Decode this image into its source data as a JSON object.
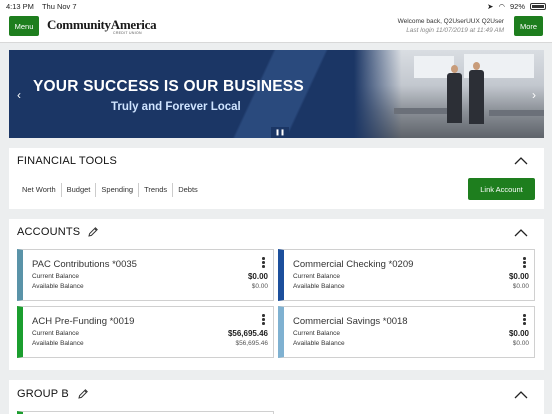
{
  "status_bar": {
    "time": "4:13 PM",
    "date": "Thu Nov 7",
    "battery": "92%",
    "battery_level": 0.92
  },
  "header": {
    "menu_label": "Menu",
    "more_label": "More",
    "logo_text": "CommunityAmerica",
    "logo_sub": "CREDIT UNION",
    "welcome": "Welcome back, Q2UserUUX Q2User",
    "last_login": "Last login 11/07/2019 at 11:49 AM"
  },
  "banner": {
    "headline": "YOUR SUCCESS IS OUR BUSINESS",
    "subline": "Truly and Forever Local",
    "prev_icon": "‹",
    "next_icon": "›",
    "pause_icon": "❚❚"
  },
  "financial_tools": {
    "title": "FINANCIAL TOOLS",
    "links": [
      "Net Worth",
      "Budget",
      "Spending",
      "Trends",
      "Debts"
    ],
    "link_account_label": "Link Account"
  },
  "accounts": {
    "title": "ACCOUNTS",
    "current_label": "Current Balance",
    "available_label": "Available Balance",
    "items": [
      {
        "name": "PAC Contributions *0035",
        "current": "$0.00",
        "available": "$0.00",
        "color": "#5a93a8"
      },
      {
        "name": "Commercial Checking *0209",
        "current": "$0.00",
        "available": "$0.00",
        "color": "#1c4f9c"
      },
      {
        "name": "ACH Pre-Funding *0019",
        "current": "$56,695.46",
        "available": "$56,695.46",
        "color": "#1b9e2e"
      },
      {
        "name": "Commercial Savings *0018",
        "current": "$0.00",
        "available": "$0.00",
        "color": "#7fb1d1"
      }
    ]
  },
  "group_b": {
    "title": "GROUP B"
  },
  "colors": {
    "accent_green": "#1e7e1e",
    "banner_navy": "#1b3665"
  }
}
